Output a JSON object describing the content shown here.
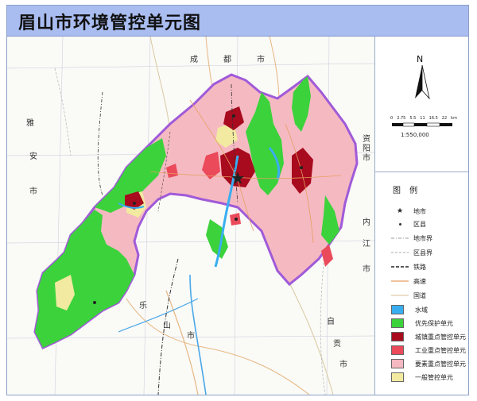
{
  "title": "眉山市环境管控单元图",
  "north_label": "N",
  "scale": {
    "ticks": [
      "0",
      "2.75",
      "5.5",
      "11",
      "16.5",
      "22"
    ],
    "unit": "km",
    "ratio": "1:550,000"
  },
  "legend": {
    "title": "图 例",
    "items": [
      {
        "label": "地市",
        "kind": "star"
      },
      {
        "label": "区县",
        "kind": "dot"
      },
      {
        "label": "地市界",
        "kind": "line-dashdot"
      },
      {
        "label": "区县界",
        "kind": "line-dash"
      },
      {
        "label": "铁路",
        "kind": "line-rail"
      },
      {
        "label": "高速",
        "kind": "line-orange"
      },
      {
        "label": "国道",
        "kind": "line-tan"
      },
      {
        "label": "水域",
        "kind": "swatch",
        "color": "#38aef0"
      },
      {
        "label": "优先保护单元",
        "kind": "swatch",
        "color": "#3cd23c"
      },
      {
        "label": "城镇重点管控单元",
        "kind": "swatch",
        "color": "#a80a1e"
      },
      {
        "label": "工业重点管控单元",
        "kind": "swatch",
        "color": "#ea4a5a"
      },
      {
        "label": "要素重点管控单元",
        "kind": "swatch",
        "color": "#f5b9c2"
      },
      {
        "label": "一般管控单元",
        "kind": "swatch",
        "color": "#f1eaa0"
      }
    ]
  },
  "map_labels": {
    "city_top_1": "成",
    "city_top_2": "都",
    "city_top_3": "市",
    "ya_1": "雅",
    "ya_2": "安",
    "ya_3": "市",
    "zi_1": "资",
    "zi_2": "阳",
    "zi_3": "市",
    "nj_1": "内",
    "nj_2": "江",
    "nj_3": "市",
    "le_1": "乐",
    "le_2": "山",
    "le_3": "市",
    "zg_1": "自",
    "zg_2": "贡",
    "zg_3": "市"
  },
  "colors": {
    "title_bar": "#a9bdf1",
    "boundary": "#a05ad8",
    "priority": "#3cd23c",
    "urban": "#a80a1e",
    "industrial": "#ea4a5a",
    "element": "#f5b9c2",
    "general": "#f1eaa0",
    "water": "#38aef0"
  }
}
